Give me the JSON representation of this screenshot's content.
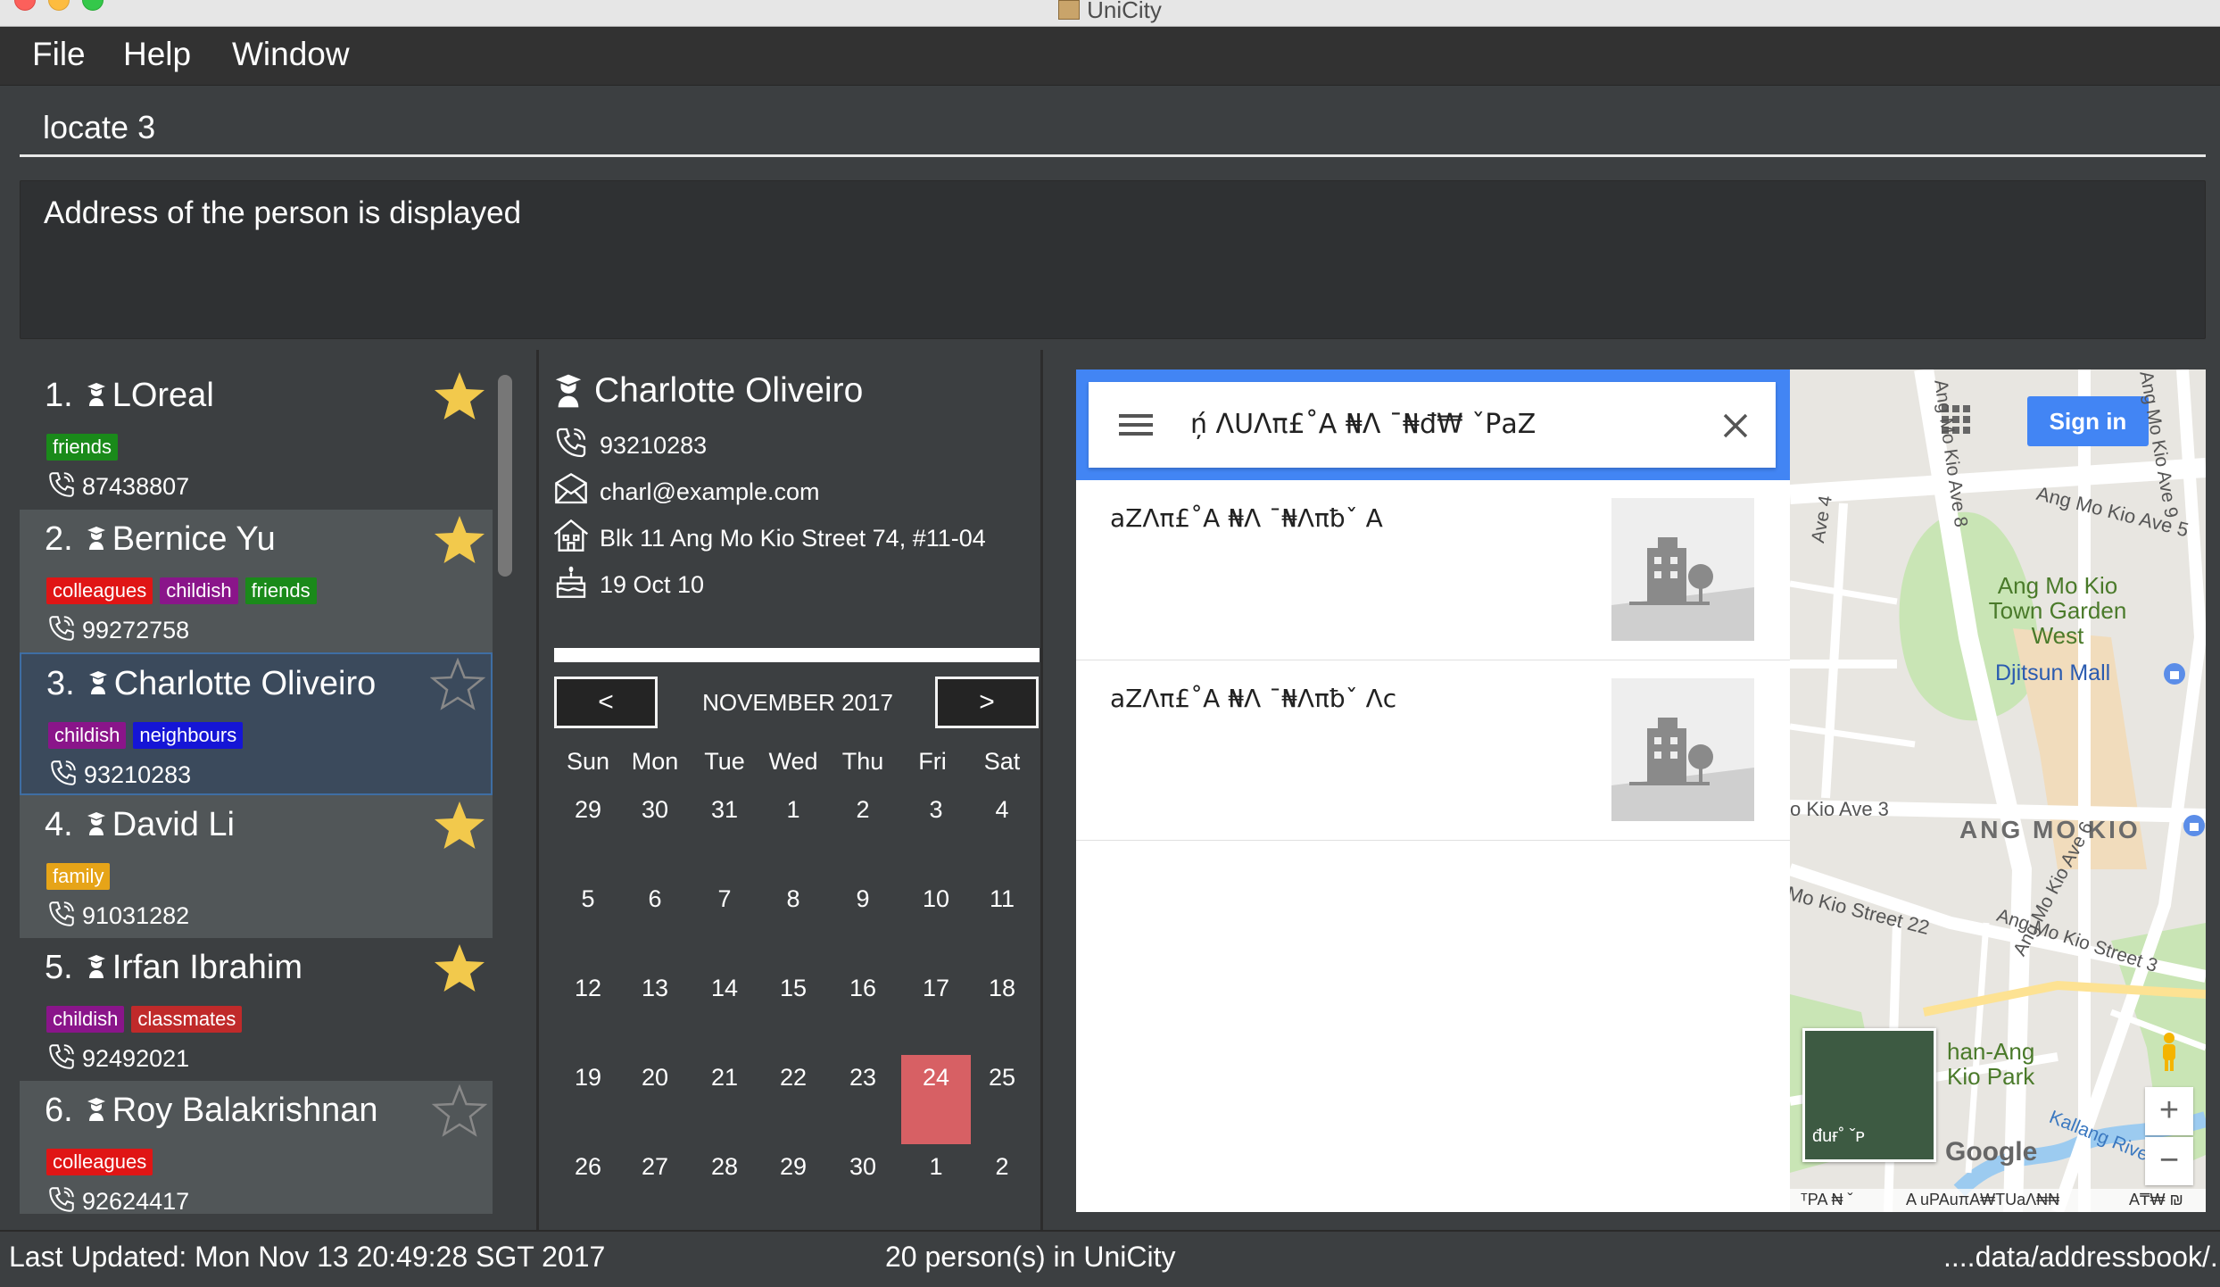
{
  "window": {
    "title": "UniCity"
  },
  "menu": {
    "file": "File",
    "help": "Help",
    "window": "Window"
  },
  "command": {
    "value": "locate 3"
  },
  "result": {
    "text": "Address of the person is displayed"
  },
  "persons": [
    {
      "index": "1.",
      "name": "LOreal",
      "tags": [
        {
          "label": "friends",
          "color": "#1a8a1a"
        }
      ],
      "phone": "87438807",
      "favorite": true
    },
    {
      "index": "2.",
      "name": "Bernice Yu",
      "tags": [
        {
          "label": "colleagues",
          "color": "#e01515"
        },
        {
          "label": "childish",
          "color": "#8a158a"
        },
        {
          "label": "friends",
          "color": "#1a8a1a"
        }
      ],
      "phone": "99272758",
      "favorite": true
    },
    {
      "index": "3.",
      "name": "Charlotte Oliveiro",
      "tags": [
        {
          "label": "childish",
          "color": "#8a158a"
        },
        {
          "label": "neighbours",
          "color": "#1515d6"
        }
      ],
      "phone": "93210283",
      "favorite": false,
      "selected": true
    },
    {
      "index": "4.",
      "name": "David Li",
      "tags": [
        {
          "label": "family",
          "color": "#e6a418"
        }
      ],
      "phone": "91031282",
      "favorite": true
    },
    {
      "index": "5.",
      "name": "Irfan Ibrahim",
      "tags": [
        {
          "label": "childish",
          "color": "#8a158a"
        },
        {
          "label": "classmates",
          "color": "#c02a2a"
        }
      ],
      "phone": "92492021",
      "favorite": true
    },
    {
      "index": "6.",
      "name": "Roy Balakrishnan",
      "tags": [
        {
          "label": "colleagues",
          "color": "#e01515"
        }
      ],
      "phone": "92624417",
      "favorite": false
    }
  ],
  "details": {
    "name": "Charlotte Oliveiro",
    "phone": "93210283",
    "email": "charl@example.com",
    "address": "Blk 11 Ang Mo Kio Street 74, #11-04",
    "birthday": "19 Oct 10"
  },
  "calendar": {
    "prev": "<",
    "next": ">",
    "month_label": "NOVEMBER 2017",
    "weekdays": [
      "Sun",
      "Mon",
      "Tue",
      "Wed",
      "Thu",
      "Fri",
      "Sat"
    ],
    "weeks": [
      [
        "29",
        "30",
        "31",
        "1",
        "2",
        "3",
        "4"
      ],
      [
        "5",
        "6",
        "7",
        "8",
        "9",
        "10",
        "11"
      ],
      [
        "12",
        "13",
        "14",
        "15",
        "16",
        "17",
        "18"
      ],
      [
        "19",
        "20",
        "21",
        "22",
        "23",
        "24",
        "25"
      ],
      [
        "26",
        "27",
        "28",
        "29",
        "30",
        "1",
        "2"
      ]
    ],
    "today": "24"
  },
  "browser": {
    "search_text": "ņ́ ΛUΛπ£˚Α ₦Λ ¯₦đ₩ ˇΡaZ",
    "results": [
      {
        "text": "aZΛπ£˚Α ₦Λ ¯₦Λπƀˇ Α"
      },
      {
        "text": "aZΛπ£˚Α ₦Λ ¯₦Λπƀˇ Λc"
      }
    ],
    "sign_in": "Sign in",
    "map_labels": {
      "park": "Ang Mo Kio Town Garden West",
      "mall": "Djitsun Mall",
      "district": "ANG MO KIO",
      "street_22": "Mo Kio Street 22",
      "ave_3": "o Kio Ave 3",
      "ave_5": "Ang Mo Kio Ave 5",
      "ave_6": "Ang Mo Kio Ave 6",
      "ave_8": "Ang Mo Kio Ave 8",
      "ave_9": "Ang Mo Kio Ave 9",
      "ave_4": "Ave 4",
      "street_3": "Ang Mo Kio Street 3",
      "park2": "han-Ang Kio Park",
      "river": "Kallang River",
      "google": "Google",
      "satellite": "đuғ˚ ˇᴘ",
      "footer_left": "ᵀΡΑ ₦ ˇ",
      "footer_mid": "Α uΡΑuπΑ₩TUaΛ₦₦",
      "footer_right": "Α₸₩ ₪"
    },
    "zoom_in": "+",
    "zoom_out": "−"
  },
  "status": {
    "last_updated": "Last Updated: Mon Nov 13 20:49:28 SGT 2017",
    "count": "20 person(s) in UniCity",
    "path": "....data/addressbook/."
  }
}
